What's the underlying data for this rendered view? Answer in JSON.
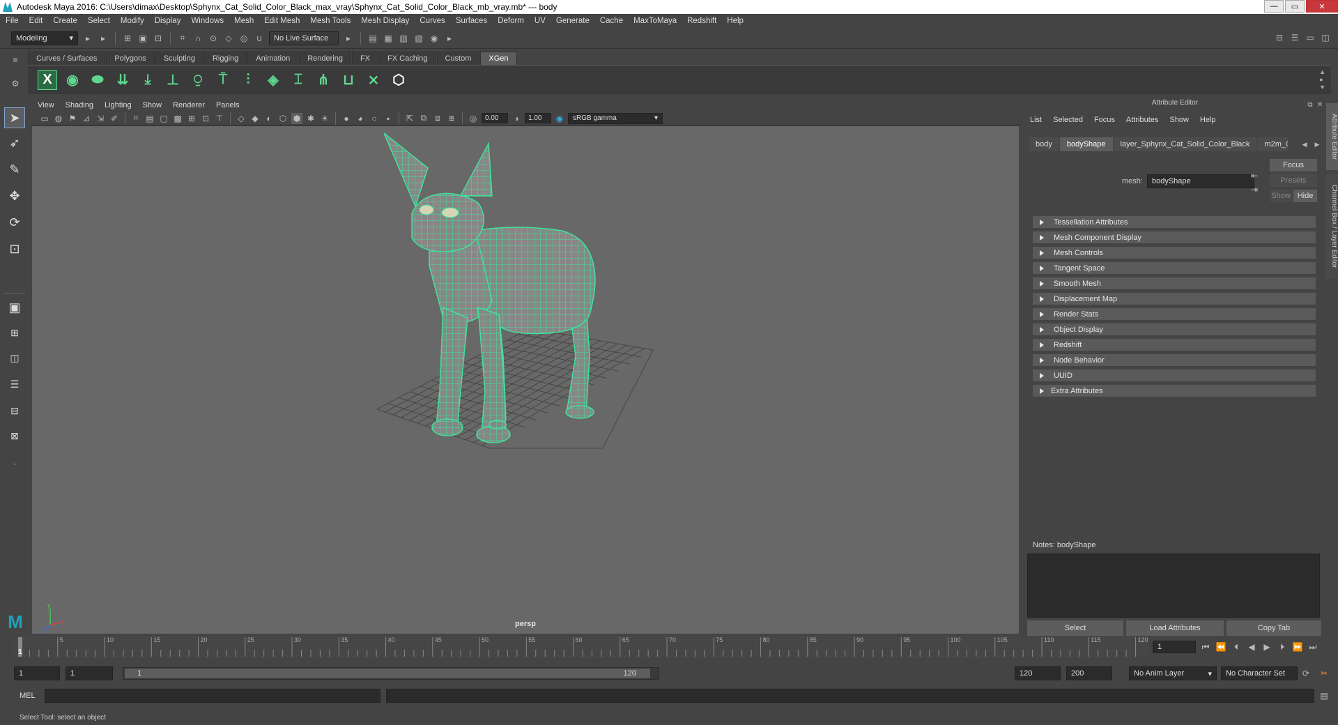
{
  "window": {
    "title": "Autodesk Maya 2016: C:\\Users\\dimax\\Desktop\\Sphynx_Cat_Solid_Color_Black_max_vray\\Sphynx_Cat_Solid_Color_Black_mb_vray.mb*  ---  body",
    "minimize": "—",
    "maximize": "▭",
    "close": "✕"
  },
  "menubar": [
    "File",
    "Edit",
    "Create",
    "Select",
    "Modify",
    "Display",
    "Windows",
    "Mesh",
    "Edit Mesh",
    "Mesh Tools",
    "Mesh Display",
    "Curves",
    "Surfaces",
    "Deform",
    "UV",
    "Generate",
    "Cache",
    "MaxToMaya",
    "Redshift",
    "Help"
  ],
  "statusline": {
    "mode": "Modeling",
    "live_surface": "No Live Surface"
  },
  "shelf": {
    "tabs": [
      "Curves / Surfaces",
      "Polygons",
      "Sculpting",
      "Rigging",
      "Animation",
      "Rendering",
      "FX",
      "FX Caching",
      "Custom",
      "XGen"
    ],
    "active_tab": "XGen"
  },
  "panel": {
    "menus": [
      "View",
      "Shading",
      "Lighting",
      "Show",
      "Renderer",
      "Panels"
    ],
    "exposure": "0.00",
    "gamma": "1.00",
    "color_space": "sRGB gamma",
    "camera_label": "persp"
  },
  "attribute_editor": {
    "header": "Attribute Editor",
    "menus": [
      "List",
      "Selected",
      "Focus",
      "Attributes",
      "Show",
      "Help"
    ],
    "node_tabs": [
      "body",
      "bodyShape",
      "layer_Sphynx_Cat_Solid_Color_Black",
      "m2m_C"
    ],
    "active_tab": "bodyShape",
    "mesh_label": "mesh:",
    "mesh_value": "bodyShape",
    "focus": "Focus",
    "presets": "Presets",
    "show": "Show",
    "hide": "Hide",
    "sections": [
      "Tessellation Attributes",
      "Mesh Component Display",
      "Mesh Controls",
      "Tangent Space",
      "Smooth Mesh",
      "Displacement Map",
      "Render Stats",
      "Object Display",
      "Redshift",
      "Node Behavior",
      "UUID",
      "Extra Attributes"
    ],
    "notes_label": "Notes:  bodyShape",
    "buttons": {
      "select": "Select",
      "load": "Load Attributes",
      "copy": "Copy Tab"
    }
  },
  "side_tabs": [
    "Attribute Editor",
    "Channel Box / Layer Editor"
  ],
  "timeline": {
    "ticks": [
      "5",
      "10",
      "15",
      "20",
      "25",
      "30",
      "35",
      "40",
      "45",
      "50",
      "55",
      "60",
      "65",
      "70",
      "75",
      "80",
      "85",
      "90",
      "95",
      "100",
      "105",
      "110",
      "115",
      "120"
    ],
    "current_frame_marker": "1",
    "current_frame": "1"
  },
  "range": {
    "start": "1",
    "playback_start": "1",
    "slider_start": "1",
    "slider_end": "120",
    "playback_end": "120",
    "end": "200",
    "anim_layer": "No Anim Layer",
    "character_set": "No Character Set"
  },
  "command": {
    "label": "MEL"
  },
  "help_line": "Select Tool: select an object",
  "colors": {
    "wire": "#3fe39a",
    "viewport_bg": "#686868",
    "active_tab": "#5d5d5d"
  }
}
